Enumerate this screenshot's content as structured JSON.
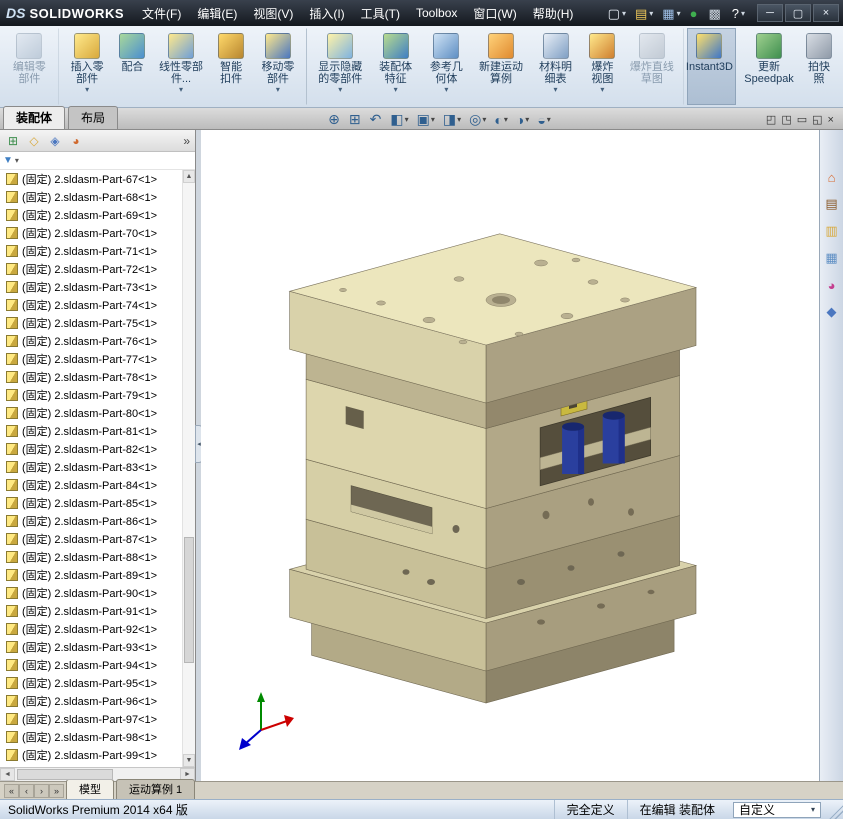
{
  "title_bar": {
    "brand_prefix": "DS",
    "brand": "SOLIDWORKS",
    "menus": [
      "文件(F)",
      "编辑(E)",
      "视图(V)",
      "插入(I)",
      "工具(T)",
      "Toolbox",
      "窗口(W)",
      "帮助(H)"
    ],
    "quick_icons": [
      {
        "name": "new-document-icon",
        "glyph": "▢",
        "color": "#e8eef6",
        "arrow": "▾"
      },
      {
        "name": "open-icon",
        "glyph": "▤",
        "color": "#f0c95a",
        "arrow": "▾"
      },
      {
        "name": "save-icon",
        "glyph": "▦",
        "color": "#9fc0e8",
        "arrow": "▾"
      },
      {
        "name": "rebuild-icon",
        "glyph": "●",
        "color": "#3fae4f",
        "arrow": ""
      },
      {
        "name": "options-icon",
        "glyph": "▩",
        "color": "#cfd8e2",
        "arrow": ""
      },
      {
        "name": "help-icon",
        "glyph": "?",
        "color": "#ffffff",
        "arrow": "▾"
      }
    ],
    "window_controls": [
      {
        "name": "minimize-button",
        "glyph": "─"
      },
      {
        "name": "maximize-button",
        "glyph": "▢"
      },
      {
        "name": "close-button",
        "glyph": "×"
      }
    ]
  },
  "ribbon": {
    "buttons": [
      {
        "label": "编辑零部件",
        "icon_bg": "linear-gradient(135deg,#d8e0ea,#93a7bc)",
        "arrow": "",
        "cls": "disabled gend"
      },
      {
        "label": "插入零部件",
        "icon_bg": "linear-gradient(135deg,#ffe98c,#d8a93c)",
        "arrow": "▾",
        "cls": ""
      },
      {
        "label": "配合",
        "icon_bg": "linear-gradient(135deg,#a8d89a,#4b8fd0)",
        "arrow": "",
        "cls": ""
      },
      {
        "label": "线性零部件...",
        "icon_bg": "linear-gradient(135deg,#ffe98c,#6f9fd8)",
        "arrow": "▾",
        "cls": ""
      },
      {
        "label": "智能扣件",
        "icon_bg": "linear-gradient(135deg,#ffd96a,#b8862f)",
        "arrow": "",
        "cls": ""
      },
      {
        "label": "移动零部件",
        "icon_bg": "linear-gradient(135deg,#ffe98c,#4b77c0)",
        "arrow": "▾",
        "cls": "gend"
      },
      {
        "label": "显示隐藏的零部件",
        "icon_bg": "linear-gradient(135deg,#fff3a8,#7fb3e0)",
        "arrow": "▾",
        "cls": ""
      },
      {
        "label": "装配体特征",
        "icon_bg": "linear-gradient(135deg,#b9dc8e,#3f7fc4)",
        "arrow": "▾",
        "cls": ""
      },
      {
        "label": "参考几何体",
        "icon_bg": "linear-gradient(135deg,#cfe2f4,#5f8fc4)",
        "arrow": "▾",
        "cls": ""
      },
      {
        "label": "新建运动算例",
        "icon_bg": "linear-gradient(135deg,#ffd27a,#e08a2f)",
        "arrow": "",
        "cls": ""
      },
      {
        "label": "材料明细表",
        "icon_bg": "linear-gradient(135deg,#e8eef6,#7f9fc4)",
        "arrow": "▾",
        "cls": ""
      },
      {
        "label": "爆炸视图",
        "icon_bg": "linear-gradient(135deg,#ffe98c,#cf7f2f)",
        "arrow": "▾",
        "cls": ""
      },
      {
        "label": "爆炸直线草图",
        "icon_bg": "linear-gradient(135deg,#d8dde4,#9aa4b0)",
        "arrow": "",
        "cls": "disabled gend"
      },
      {
        "label": "Instant3D",
        "icon_bg": "linear-gradient(135deg,#ffe06a,#3f77c8)",
        "arrow": "",
        "cls": "active gend"
      },
      {
        "label": "更新 Speedpak",
        "icon_bg": "linear-gradient(135deg,#9fd08f,#3f8f4f)",
        "arrow": "",
        "cls": ""
      },
      {
        "label": "拍快照",
        "icon_bg": "linear-gradient(135deg,#d8dde4,#8f9aa8)",
        "arrow": "",
        "cls": ""
      }
    ],
    "tabs": [
      {
        "label": "装配体",
        "cls": "active"
      },
      {
        "label": "布局",
        "cls": ""
      }
    ]
  },
  "hud": {
    "icons": [
      {
        "name": "zoom-fit-icon",
        "glyph": "⊕",
        "arrow": ""
      },
      {
        "name": "zoom-area-icon",
        "glyph": "⊞",
        "arrow": ""
      },
      {
        "name": "previous-view-icon",
        "glyph": "↶",
        "arrow": ""
      },
      {
        "name": "section-view-icon",
        "glyph": "◧",
        "arrow": "▾"
      },
      {
        "name": "view-orientation-icon",
        "glyph": "▣",
        "arrow": "▾"
      },
      {
        "name": "display-style-icon",
        "glyph": "◨",
        "arrow": "▾"
      },
      {
        "name": "hide-show-items-icon",
        "glyph": "◎",
        "arrow": "▾"
      },
      {
        "name": "edit-appearance-icon",
        "glyph": "◐",
        "arrow": "▾"
      },
      {
        "name": "apply-scene-icon",
        "glyph": "◑",
        "arrow": "▾"
      },
      {
        "name": "view-settings-icon",
        "glyph": "◒",
        "arrow": "▾"
      }
    ]
  },
  "doc_window": {
    "icons": [
      {
        "name": "pane-left-icon",
        "glyph": "◰"
      },
      {
        "name": "pane-right-icon",
        "glyph": "◳"
      },
      {
        "name": "doc-minimize-icon",
        "glyph": "▭"
      },
      {
        "name": "doc-restore-icon",
        "glyph": "◱"
      },
      {
        "name": "doc-close-icon",
        "glyph": "×"
      }
    ]
  },
  "panel": {
    "header_icons": [
      {
        "name": "featuremanager-tab-icon",
        "glyph": "⊞",
        "color": "#3f8f4f"
      },
      {
        "name": "propertymanager-tab-icon",
        "glyph": "◇",
        "color": "#d8a93c"
      },
      {
        "name": "configurationmanager-tab-icon",
        "glyph": "◈",
        "color": "#4b77c0"
      },
      {
        "name": "displaymanager-tab-icon",
        "glyph": "◕",
        "color": "#d06a2f"
      }
    ],
    "expand_glyph": "»",
    "collapse_glyph": "◂",
    "filter": {
      "funnel_glyph": "▼",
      "arrow": "▾"
    },
    "scroll_up_glyph": "▲",
    "scroll_down_glyph": "▼",
    "hscroll_left": "◄",
    "hscroll_right": "►",
    "tree_items": [
      {
        "label": "(固定) 2.sldasm-Part-67<1>"
      },
      {
        "label": "(固定) 2.sldasm-Part-68<1>"
      },
      {
        "label": "(固定) 2.sldasm-Part-69<1>"
      },
      {
        "label": "(固定) 2.sldasm-Part-70<1>"
      },
      {
        "label": "(固定) 2.sldasm-Part-71<1>"
      },
      {
        "label": "(固定) 2.sldasm-Part-72<1>"
      },
      {
        "label": "(固定) 2.sldasm-Part-73<1>"
      },
      {
        "label": "(固定) 2.sldasm-Part-74<1>"
      },
      {
        "label": "(固定) 2.sldasm-Part-75<1>"
      },
      {
        "label": "(固定) 2.sldasm-Part-76<1>"
      },
      {
        "label": "(固定) 2.sldasm-Part-77<1>"
      },
      {
        "label": "(固定) 2.sldasm-Part-78<1>"
      },
      {
        "label": "(固定) 2.sldasm-Part-79<1>"
      },
      {
        "label": "(固定) 2.sldasm-Part-80<1>"
      },
      {
        "label": "(固定) 2.sldasm-Part-81<1>"
      },
      {
        "label": "(固定) 2.sldasm-Part-82<1>"
      },
      {
        "label": "(固定) 2.sldasm-Part-83<1>"
      },
      {
        "label": "(固定) 2.sldasm-Part-84<1>"
      },
      {
        "label": "(固定) 2.sldasm-Part-85<1>"
      },
      {
        "label": "(固定) 2.sldasm-Part-86<1>"
      },
      {
        "label": "(固定) 2.sldasm-Part-87<1>"
      },
      {
        "label": "(固定) 2.sldasm-Part-88<1>"
      },
      {
        "label": "(固定) 2.sldasm-Part-89<1>"
      },
      {
        "label": "(固定) 2.sldasm-Part-90<1>"
      },
      {
        "label": "(固定) 2.sldasm-Part-91<1>"
      },
      {
        "label": "(固定) 2.sldasm-Part-92<1>"
      },
      {
        "label": "(固定) 2.sldasm-Part-93<1>"
      },
      {
        "label": "(固定) 2.sldasm-Part-94<1>"
      },
      {
        "label": "(固定) 2.sldasm-Part-95<1>"
      },
      {
        "label": "(固定) 2.sldasm-Part-96<1>"
      },
      {
        "label": "(固定) 2.sldasm-Part-97<1>"
      },
      {
        "label": "(固定) 2.sldasm-Part-98<1>"
      },
      {
        "label": "(固定) 2.sldasm-Part-99<1>"
      }
    ]
  },
  "taskpane": {
    "icons": [
      {
        "name": "taskpane-home-icon",
        "glyph": "⌂",
        "color": "#d86a2f"
      },
      {
        "name": "design-library-icon",
        "glyph": "▤",
        "color": "#8a5a2a"
      },
      {
        "name": "file-explorer-icon",
        "glyph": "▥",
        "color": "#d8a93c"
      },
      {
        "name": "view-palette-icon",
        "glyph": "▦",
        "color": "#5f8fc4"
      },
      {
        "name": "appearances-icon",
        "glyph": "◕",
        "color": "#c43f8f"
      },
      {
        "name": "custom-properties-icon",
        "glyph": "◆",
        "color": "#4b77c0"
      }
    ]
  },
  "viewport": {
    "triad": {
      "x_color": "#cc0000",
      "y_color": "#008a00",
      "z_color": "#0000cc"
    }
  },
  "bottom_tabs": {
    "nav": [
      {
        "name": "tab-scroll-first-icon",
        "glyph": "«"
      },
      {
        "name": "tab-scroll-prev-icon",
        "glyph": "‹"
      },
      {
        "name": "tab-scroll-next-icon",
        "glyph": "›"
      },
      {
        "name": "tab-scroll-last-icon",
        "glyph": "»"
      }
    ],
    "tabs": [
      {
        "label": "模型",
        "cls": "active"
      },
      {
        "label": "运动算例 1",
        "cls": ""
      }
    ]
  },
  "status_bar": {
    "left_text": "SolidWorks Premium 2014 x64 版",
    "segments": [
      "完全定义",
      "在编辑 装配体"
    ],
    "custom_label": "自定义",
    "combo_arrow": "▾"
  },
  "colors": {
    "titlebar_bg": "#1d232c",
    "model_plate_light": "#ece6bd",
    "model_plate_shadow": "#aba183",
    "model_pillar_blue": "#2a3f9e"
  }
}
